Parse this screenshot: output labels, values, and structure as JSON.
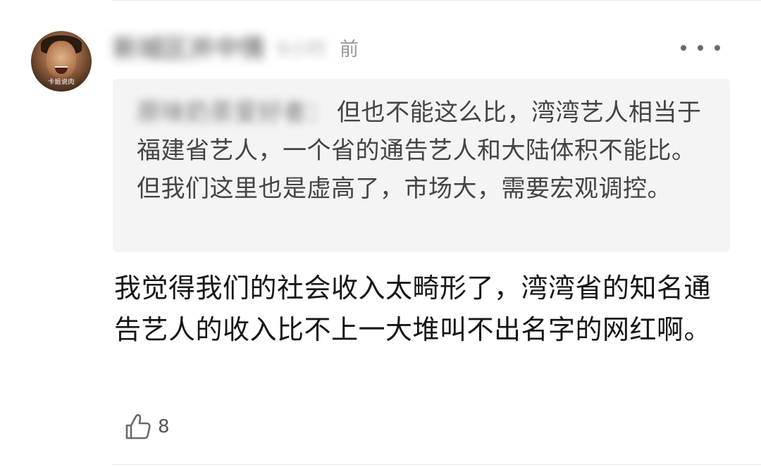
{
  "comment": {
    "author_name": "新城区并中情",
    "time_blurred": "9小时",
    "time_suffix": "前",
    "quote": {
      "author": "原味奶茶爱好者：",
      "text": "但也不能这么比，湾湾艺人相当于福建省艺人，一个省的通告艺人和大陆体积不能比。但我们这里也是虚高了，市场大，需要宏观调控。"
    },
    "text": "我觉得我们的社会收入太畸形了，湾湾省的知名通告艺人的收入比不上一大堆叫不出名字的网红啊。",
    "like_count": "8",
    "avatar_tag": "卡姐说肉"
  },
  "icons": {
    "more": "more-dots-icon",
    "like": "thumbs-up-icon"
  },
  "colors": {
    "quote_background": "#f4f4f4",
    "text": "#161616",
    "secondary_text": "#9a9a9a"
  }
}
